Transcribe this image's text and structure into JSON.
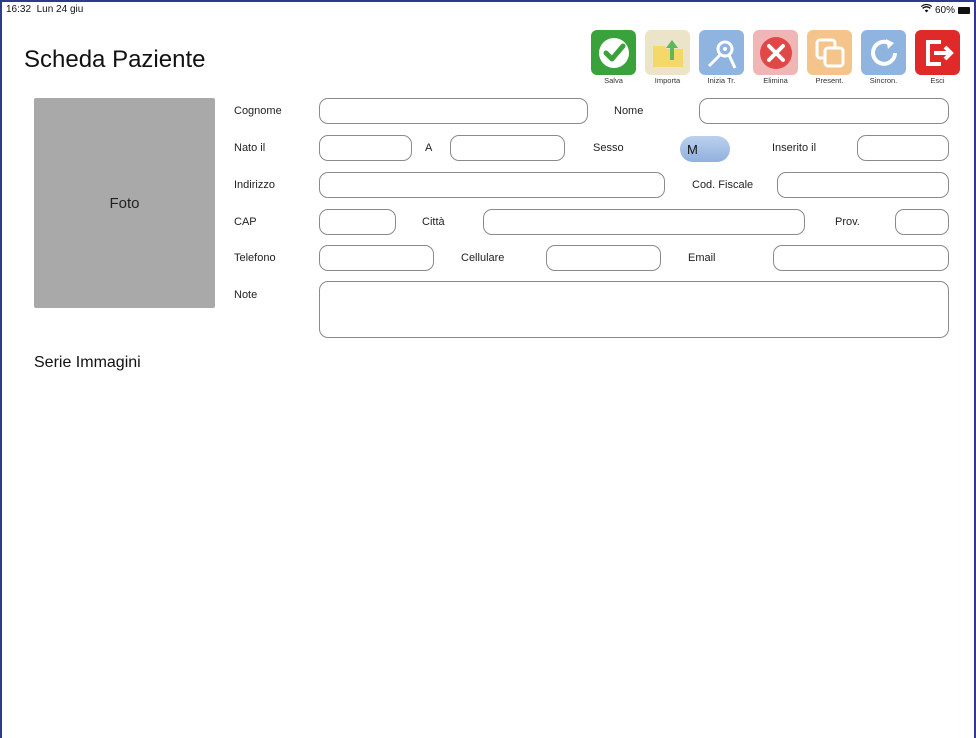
{
  "status": {
    "time": "16:32",
    "date": "Lun 24 giu",
    "battery": "60%"
  },
  "title": "Scheda Paziente",
  "toolbar": [
    {
      "label": "Salva",
      "color": "#3aa23a",
      "icon": "check-icon"
    },
    {
      "label": "Importa",
      "color": "#e8dcb0",
      "icon": "import-icon"
    },
    {
      "label": "Inizia Tr.",
      "color": "#8fb4e0",
      "icon": "start-icon"
    },
    {
      "label": "Elimina",
      "color": "#e88a8a",
      "icon": "delete-icon"
    },
    {
      "label": "Present.",
      "color": "#f4c48a",
      "icon": "presentation-icon"
    },
    {
      "label": "Sincron.",
      "color": "#8fb4e0",
      "icon": "sync-icon"
    },
    {
      "label": "Esci",
      "color": "#e02a2a",
      "icon": "exit-icon"
    }
  ],
  "photo": {
    "label": "Foto"
  },
  "form": {
    "cognome": "Cognome",
    "nome": "Nome",
    "nato_il": "Nato il",
    "a": "A",
    "sesso": "Sesso",
    "sesso_value": "M",
    "inserito_il": "Inserito il",
    "indirizzo": "Indirizzo",
    "cod_fiscale": "Cod. Fiscale",
    "cap": "CAP",
    "citta": "Città",
    "prov": "Prov.",
    "telefono": "Telefono",
    "cellulare": "Cellulare",
    "email": "Email",
    "note": "Note"
  },
  "series_title": "Serie Immagini"
}
